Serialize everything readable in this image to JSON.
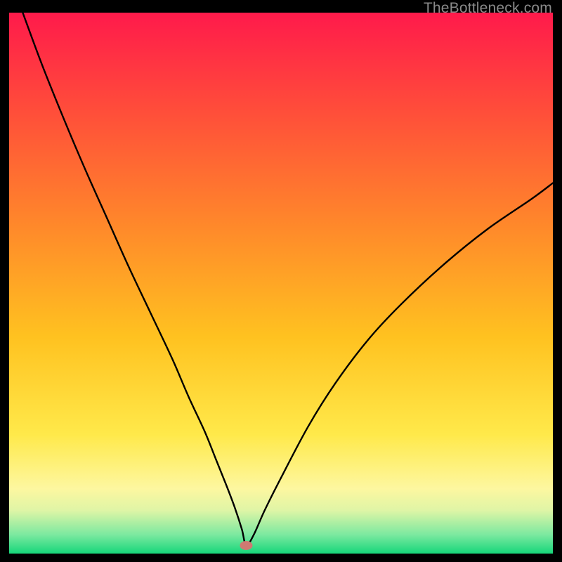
{
  "watermark": "TheBottleneck.com",
  "chart_data": {
    "type": "line",
    "title": "",
    "xlabel": "",
    "ylabel": "",
    "xlim": [
      0,
      100
    ],
    "ylim": [
      0,
      100
    ],
    "grid": false,
    "legend": false,
    "background_gradient_stops": [
      {
        "t": 0.0,
        "color": "#ff1a4b"
      },
      {
        "t": 0.18,
        "color": "#ff4d3a"
      },
      {
        "t": 0.4,
        "color": "#ff8a2a"
      },
      {
        "t": 0.6,
        "color": "#ffc220"
      },
      {
        "t": 0.78,
        "color": "#ffe94a"
      },
      {
        "t": 0.88,
        "color": "#fdf7a0"
      },
      {
        "t": 0.92,
        "color": "#dff5a6"
      },
      {
        "t": 0.965,
        "color": "#7ce9a0"
      },
      {
        "t": 1.0,
        "color": "#16d67a"
      }
    ],
    "marker": {
      "x": 43.6,
      "y": 1.5,
      "color": "#cf7a72"
    },
    "series": [
      {
        "name": "curve",
        "x": [
          2.5,
          6,
          10,
          14,
          18,
          22,
          26,
          30,
          33,
          36,
          38,
          40,
          41.5,
          42.8,
          43.6,
          45,
          47,
          50,
          55,
          60,
          66,
          72,
          80,
          88,
          96,
          100
        ],
        "y": [
          100,
          90.5,
          80.5,
          71,
          62,
          53,
          44.5,
          36,
          29,
          22.5,
          17.5,
          12.5,
          8.5,
          4.5,
          1.5,
          3.5,
          8,
          14,
          23.5,
          31.5,
          39.5,
          46,
          53.5,
          60,
          65.5,
          68.5
        ]
      }
    ]
  }
}
